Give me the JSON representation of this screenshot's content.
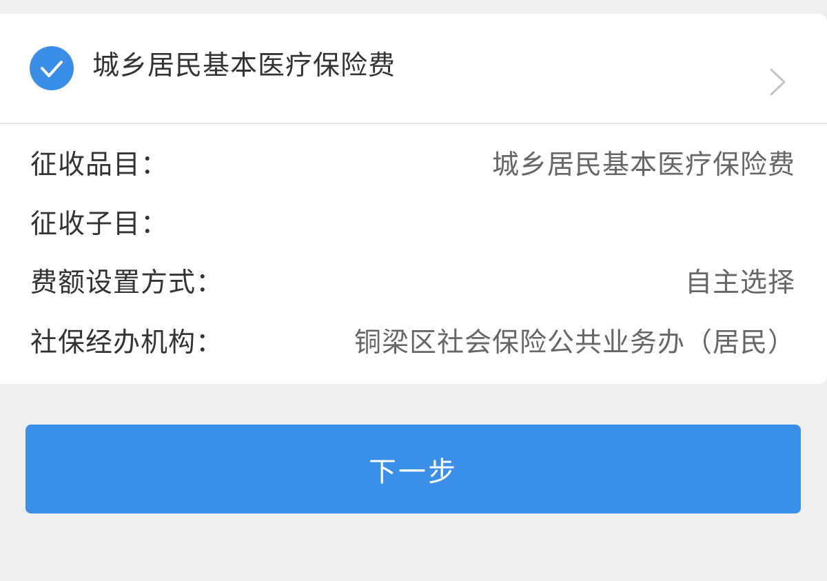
{
  "item_card": {
    "selected": true,
    "title": "城乡居民基本医疗保险费",
    "check_icon": "check-circle-icon",
    "chevron_icon": "chevron-right-icon",
    "accent_color": "#3a8ee8"
  },
  "details": [
    {
      "label": "征收品目：",
      "value": "城乡居民基本医疗保险费"
    },
    {
      "label": "征收子目：",
      "value": ""
    },
    {
      "label": "费额设置方式：",
      "value": "自主选择"
    },
    {
      "label": "社保经办机构：",
      "value": "铜梁区社会保险公共业务办（居民）"
    }
  ],
  "actions": {
    "next_label": "下一步",
    "button_color": "#3b8fe9"
  }
}
